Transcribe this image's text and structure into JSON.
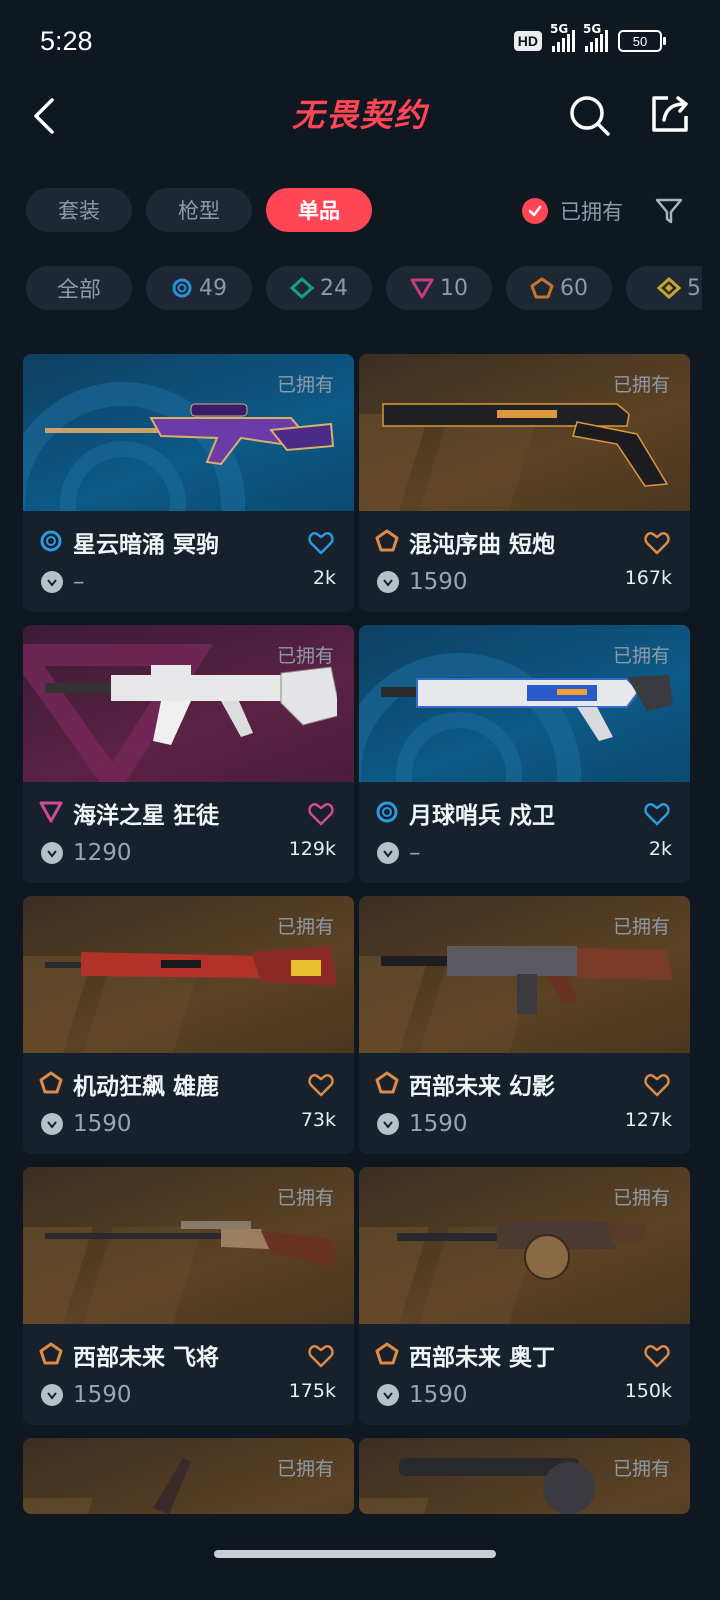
{
  "status": {
    "time": "5:28",
    "hd": "HD",
    "net1": "5G",
    "net2": "5G",
    "battery": "50"
  },
  "header": {
    "logo": "无畏契约"
  },
  "tabs": [
    {
      "label": "套装"
    },
    {
      "label": "枪型"
    },
    {
      "label": "单品"
    }
  ],
  "owned_filter": {
    "label": "已拥有"
  },
  "chips": [
    {
      "label": "全部"
    },
    {
      "count": "49",
      "icon": "select-tier-icon",
      "color": "#2b8fd6"
    },
    {
      "count": "24",
      "icon": "deluxe-tier-icon",
      "color": "#15a090"
    },
    {
      "count": "10",
      "icon": "premium-tier-icon",
      "color": "#c53b86"
    },
    {
      "count": "60",
      "icon": "exclusive-tier-icon",
      "color": "#c8732e"
    },
    {
      "count": "5",
      "icon": "ultra-tier-icon",
      "color": "#c8a52e"
    }
  ],
  "cards": [
    {
      "name": "星云暗涌 冥驹",
      "price": "–",
      "likes": "2k",
      "owned": "已拥有",
      "tier": "blue"
    },
    {
      "name": "混沌序曲 短炮",
      "price": "1590",
      "likes": "167k",
      "owned": "已拥有",
      "tier": "orange"
    },
    {
      "name": "海洋之星 狂徒",
      "price": "1290",
      "likes": "129k",
      "owned": "已拥有",
      "tier": "purple"
    },
    {
      "name": "月球哨兵 戍卫",
      "price": "–",
      "likes": "2k",
      "owned": "已拥有",
      "tier": "blue"
    },
    {
      "name": "机动狂飙 雄鹿",
      "price": "1590",
      "likes": "73k",
      "owned": "已拥有",
      "tier": "orange"
    },
    {
      "name": "西部未来 幻影",
      "price": "1590",
      "likes": "127k",
      "owned": "已拥有",
      "tier": "orange"
    },
    {
      "name": "西部未来 飞将",
      "price": "1590",
      "likes": "175k",
      "owned": "已拥有",
      "tier": "orange"
    },
    {
      "name": "西部未来 奥丁",
      "price": "1590",
      "likes": "150k",
      "owned": "已拥有",
      "tier": "orange"
    },
    {
      "owned": "已拥有",
      "tier": "orange"
    },
    {
      "owned": "已拥有",
      "tier": "orange"
    }
  ],
  "colors": {
    "accent": "#ff4655",
    "blue_tier": "#2b9be0",
    "orange_tier": "#e08a45",
    "purple_tier": "#d04a96"
  }
}
